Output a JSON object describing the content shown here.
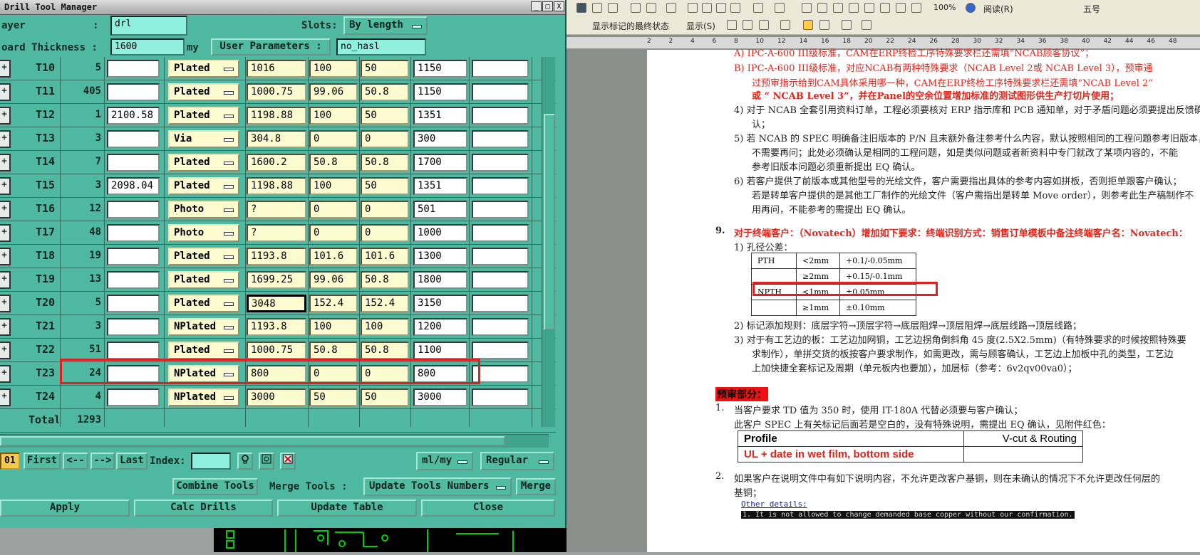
{
  "dtm": {
    "title": "Drill Tool Manager",
    "win_buttons": [
      "_",
      "□",
      "X"
    ],
    "layer_label": "ayer",
    "layer_sep": ":",
    "layer_value": "drl",
    "slots_label": "Slots:",
    "slots_value": "By length",
    "board_thickness_label": "oard Thickness :",
    "board_thickness_value": "1600",
    "board_thickness_unit": "my",
    "user_params_label": "User Parameters :",
    "user_params_value": "no_hasl",
    "rows": [
      {
        "tool": "T10",
        "count": "5",
        "c3": "",
        "type": "Plated",
        "c5": "1016",
        "c6": "100",
        "c7": "50",
        "c8": "1150",
        "c9": ""
      },
      {
        "tool": "T11",
        "count": "405",
        "c3": "",
        "type": "Plated",
        "c5": "1000.75",
        "c6": "99.06",
        "c7": "50.8",
        "c8": "1150",
        "c9": ""
      },
      {
        "tool": "T12",
        "count": "1",
        "c3": "2100.58",
        "type": "Plated",
        "c5": "1198.88",
        "c6": "100",
        "c7": "50",
        "c8": "1351",
        "c9": ""
      },
      {
        "tool": "T13",
        "count": "3",
        "c3": "",
        "type": "Via",
        "c5": "304.8",
        "c6": "0",
        "c7": "0",
        "c8": "300",
        "c9": ""
      },
      {
        "tool": "T14",
        "count": "7",
        "c3": "",
        "type": "Plated",
        "c5": "1600.2",
        "c6": "50.8",
        "c7": "50.8",
        "c8": "1700",
        "c9": ""
      },
      {
        "tool": "T15",
        "count": "3",
        "c3": "2098.04",
        "type": "Plated",
        "c5": "1198.88",
        "c6": "100",
        "c7": "50",
        "c8": "1351",
        "c9": ""
      },
      {
        "tool": "T16",
        "count": "12",
        "c3": "",
        "type": "Photo",
        "c5": "?",
        "c6": "0",
        "c7": "0",
        "c8": "501",
        "c9": ""
      },
      {
        "tool": "T17",
        "count": "48",
        "c3": "",
        "type": "Photo",
        "c5": "?",
        "c6": "0",
        "c7": "0",
        "c8": "1000",
        "c9": ""
      },
      {
        "tool": "T18",
        "count": "19",
        "c3": "",
        "type": "Plated",
        "c5": "1193.8",
        "c6": "101.6",
        "c7": "101.6",
        "c8": "1300",
        "c9": ""
      },
      {
        "tool": "T19",
        "count": "13",
        "c3": "",
        "type": "Plated",
        "c5": "1699.25",
        "c6": "99.06",
        "c7": "50.8",
        "c8": "1800",
        "c9": ""
      },
      {
        "tool": "T20",
        "count": "5",
        "c3": "",
        "type": "Plated",
        "c5": "3048",
        "c6": "152.4",
        "c7": "152.4",
        "c8": "3150",
        "c9": ""
      },
      {
        "tool": "T21",
        "count": "3",
        "c3": "",
        "type": "NPlated",
        "c5": "1193.8",
        "c6": "100",
        "c7": "100",
        "c8": "1200",
        "c9": ""
      },
      {
        "tool": "T22",
        "count": "51",
        "c3": "",
        "type": "Plated",
        "c5": "1000.75",
        "c6": "50.8",
        "c7": "50.8",
        "c8": "1100",
        "c9": ""
      },
      {
        "tool": "T23",
        "count": "24",
        "c3": "",
        "type": "NPlated",
        "c5": "800",
        "c6": "0",
        "c7": "0",
        "c8": "800",
        "c9": ""
      },
      {
        "tool": "T24",
        "count": "4",
        "c3": "",
        "type": "NPlated",
        "c5": "3000",
        "c6": "50",
        "c7": "50",
        "c8": "3000",
        "c9": ""
      }
    ],
    "total_label": "Total",
    "total_value": "1293",
    "nav": {
      "counter": "01",
      "first": "First",
      "prev": "<--",
      "next": "-->",
      "last": "Last",
      "index_label": "Index:",
      "index_value": ""
    },
    "units_value": "ml/my",
    "mode_value": "Regular",
    "combine_tools": "Combine Tools",
    "merge_tools_label": "Merge Tools :",
    "update_tools_numbers": "Update Tools Numbers",
    "merge": "Merge",
    "apply": "Apply",
    "calc_drills": "Calc Drills",
    "update_table": "Update Table",
    "close": "Close"
  },
  "word": {
    "toolbar1": {
      "zoom": "100%",
      "reading": "阅读(R)",
      "font_size": "五号"
    },
    "toolbar2": {
      "show_markup": "显示标记的最终状态",
      "show": "显示(S)"
    },
    "ruler_numbers": [
      "2",
      "2",
      "4",
      "6",
      "8",
      "10",
      "12",
      "14",
      "16",
      "18",
      "20",
      "22",
      "24",
      "26",
      "28",
      "30",
      "32",
      "34",
      "36",
      "38",
      "40",
      "42",
      "44",
      "46",
      "48"
    ],
    "lines": {
      "a": "A)  IPC-A-600 III级标准，CAM在ERP终检工序特殊要求栏还需填“NCAB顾客协议”；",
      "b1": "B)  IPC-A-600 III级标准，对应NCAB有两种特殊要求（NCAB Level 2或 NCAB Level 3），预审通",
      "b2": "过预审指示给到CAM具体采用哪一种，CAM在ERP终检工序特殊要求栏还需填“NCAB Level 2”",
      "b3": "或 “ NCAB Level 3”，并在Panel的空余位置增加标准的测试图形供生产打切片使用；",
      "i4a": "4)  对于 NCAB 全套引用资料订单，工程必须要核对 ERP 指示库和 PCB 通知单，对于矛盾问题必须要提出反馈确",
      "i4b": "认；",
      "i5a": "5)  若 NCAB 的 SPEC 明确备注旧版本的 P/N 且未额外备注参考什么内容，默认按照相同的工程问题参考旧版本，",
      "i5b": "不需要再问；此处必须确认是相同的工程问题，如是类似问题或者新资料中专门就改了某项内容的，不能",
      "i5c": "参考旧版本问题必须重新提出 EQ 确认。",
      "i6a": "6)  若客户提供了前版本或其他型号的光绘文件，客户需要指出具体的参考内容如拼板，否则拒单跟客户确认；",
      "i6b": "若是转单客户提供的是其他工厂制作的光绘文件（客户需指出是转单 Move order），则参考此生产稿制作不",
      "i6c": "用再问，不能参考的需提出 EQ 确认。",
      "h9num": "9.",
      "h9": "对于终端客户：（Novatech）增加如下要求：终端识别方式：销售订单模板中备注终端客户名：Novatech：",
      "s1": "1)  孔径公差：",
      "s2": "2)  标记添加规则：底层字符→顶层字符→底层阻焊→顶层阻焊→底层线路→顶层线路；",
      "s3a": "3)  对于有工艺边的板：工艺边加网铜，工艺边拐角倒斜角 45 度(2.5X2.5mm)（有特殊要求的时候按照特殊要",
      "s3b": "求制作），单拼交货的板按客户要求制作，如需更改，需与顾客确认，工艺边上加板中孔的类型，工艺边",
      "s3c": "上加快捷全套标记及周期（单元板内也要加），加层标（参考：6v2qv00va0）；",
      "pre": "预审部分：",
      "n1num": "1.",
      "n1a": "当客户要求 TD 值为 350 时，使用 IT-180A 代替必须要与客户确认；",
      "n1b": "此客户 SPEC 上有关标记后面若是空白的，没有特殊说明，需提出 EQ 确认，见附件红色：",
      "n2num": "2.",
      "n2a": "如果客户在说明文件中有如下说明内容，不允许更改客户基铜，则在未确认的情况下不允许更改任何层的",
      "n2b": "基铜；",
      "other": "Other details:",
      "allowed": "1. It is not allowed to change demanded base copper without our confirmation."
    },
    "tol_table": [
      [
        "PTH",
        "<2mm",
        "+0.1/-0.05mm"
      ],
      [
        "",
        "≥2mm",
        "+0.15/-0.1mm"
      ],
      [
        "NPTH",
        "<1mm",
        "±0.05mm"
      ],
      [
        "",
        "≥1mm",
        "±0.10mm"
      ]
    ],
    "profile_table": {
      "profile": "Profile",
      "vcut": "V-cut & Routing",
      "ul": "UL + date in wet film, bottom side"
    }
  }
}
